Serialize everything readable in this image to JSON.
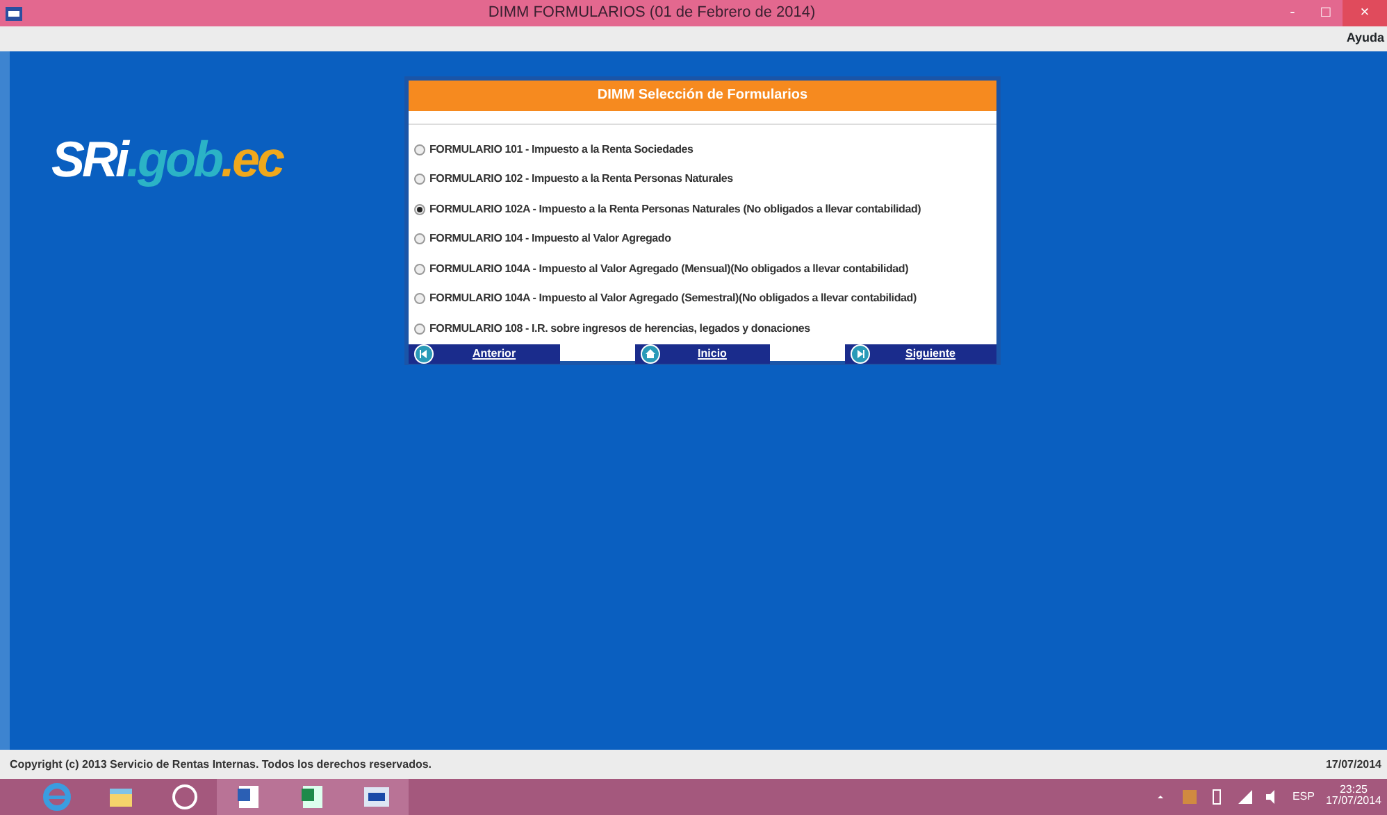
{
  "window": {
    "title": "DIMM FORMULARIOS (01 de Febrero de 2014)",
    "controls": [
      "-",
      "□",
      "×"
    ]
  },
  "menu": [
    "Ayuda"
  ],
  "logo": [
    {
      "text": "SRi",
      "color": "#ffffff"
    },
    {
      "text": ".gob",
      "color": "#2bb3c6"
    },
    {
      "text": ".ec",
      "color": "#f0a81c"
    }
  ],
  "panel": {
    "title": "DIMM Selección de Formularios",
    "options": [
      {
        "label": "FORMULARIO 101 - Impuesto a la Renta  Sociedades",
        "selected": false
      },
      {
        "label": "FORMULARIO 102 - Impuesto a la Renta  Personas Naturales",
        "selected": false
      },
      {
        "label": "FORMULARIO 102A - Impuesto a la Renta  Personas Naturales (No obligados a llevar contabilidad)",
        "selected": true
      },
      {
        "label": "FORMULARIO 104 - Impuesto al Valor Agregado",
        "selected": false
      },
      {
        "label": "FORMULARIO 104A - Impuesto al Valor Agregado (Mensual)(No obligados a llevar contabilidad)",
        "selected": false
      },
      {
        "label": "FORMULARIO 104A - Impuesto al Valor Agregado (Semestral)(No obligados a llevar contabilidad)",
        "selected": false
      },
      {
        "label": "FORMULARIO 108 - I.R. sobre ingresos de herencias, legados y donaciones",
        "selected": false
      }
    ],
    "buttons": [
      {
        "label": "Anterior",
        "kind": "back"
      },
      {
        "label": "Inicio",
        "kind": "home"
      },
      {
        "label": "Siguiente",
        "kind": "next"
      }
    ]
  },
  "status_bar": {
    "copyright": "Copyright (c) 2013 Servicio de Rentas Internas. Todos los derechos reservados.",
    "date": "17/07/2014"
  },
  "taskbar": {
    "apps": [
      {
        "kind": "browser"
      },
      {
        "kind": "folder"
      },
      {
        "kind": "hp"
      },
      {
        "kind": "word"
      },
      {
        "kind": "excel"
      },
      {
        "kind": "sri"
      }
    ],
    "language": "ESP",
    "time": "23:25",
    "date": "17/07/2014"
  }
}
